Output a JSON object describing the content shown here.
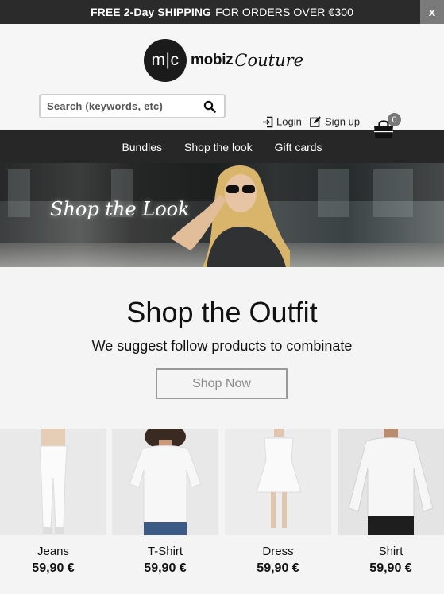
{
  "promo": {
    "bold": "FREE 2-Day SHIPPING",
    "text": "FOR ORDERS OVER €300",
    "close": "x"
  },
  "logo": {
    "mark": "m|c",
    "word1": "mobiz",
    "word2": "Couture"
  },
  "search": {
    "placeholder": "Search (keywords, etc)",
    "icon": "search-icon"
  },
  "account": {
    "login_label": "Login",
    "signup_label": "Sign up",
    "cart_count": "0"
  },
  "nav": {
    "items": [
      "Bundles",
      "Shop the look",
      "Gift cards"
    ]
  },
  "banner": {
    "script_text": "Shop the Look"
  },
  "hero": {
    "title": "Shop the Outfit",
    "subtitle": "We suggest follow products to combinate",
    "button": "Shop Now"
  },
  "products": [
    {
      "name": "Jeans",
      "price": "59,90 €"
    },
    {
      "name": "T-Shirt",
      "price": "59,90 €"
    },
    {
      "name": "Dress",
      "price": "59,90 €"
    },
    {
      "name": "Shirt",
      "price": "59,90 €"
    }
  ],
  "colors": {
    "topbar": "#2b2b2b",
    "nav": "#272727",
    "background": "#f4f4f4"
  }
}
